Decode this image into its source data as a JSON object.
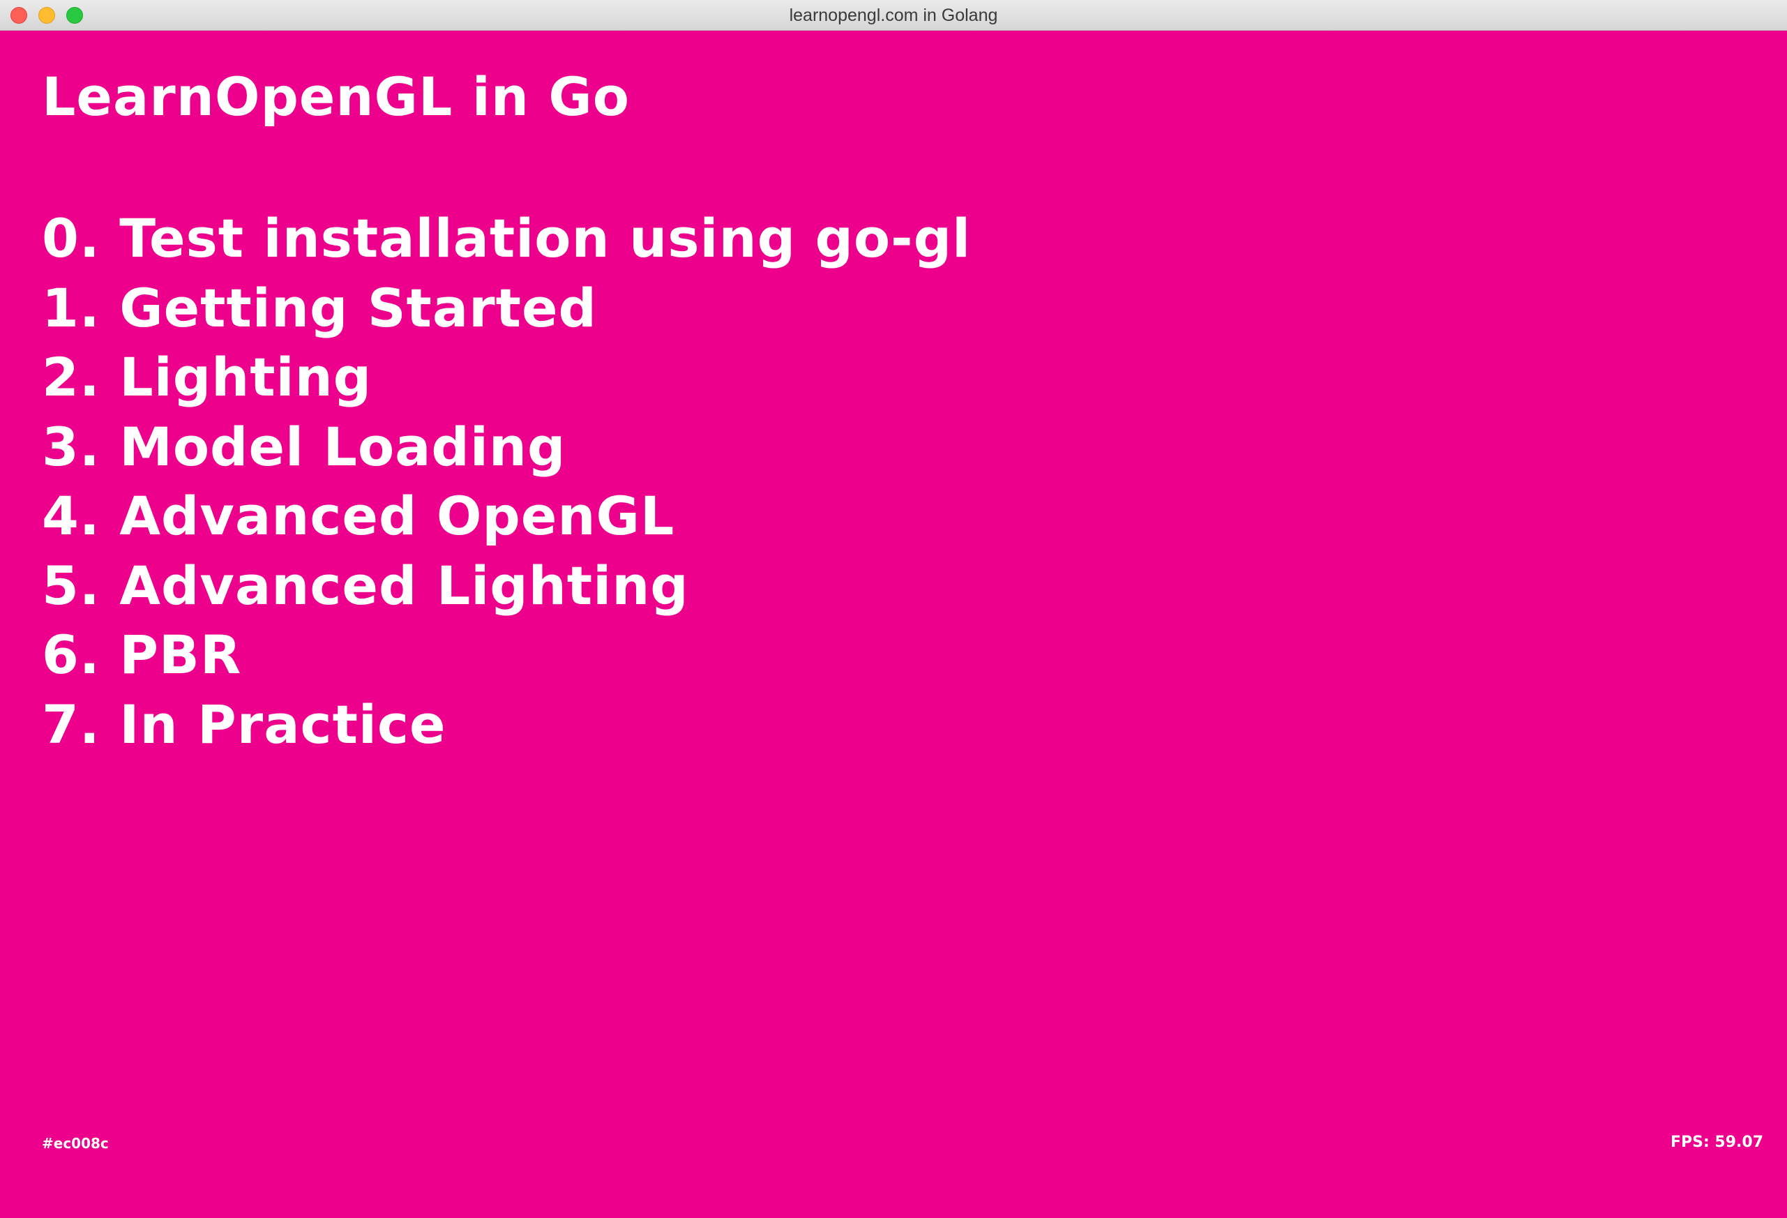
{
  "window": {
    "title": "learnopengl.com in Golang",
    "controls": [
      "close-button",
      "minimize-button",
      "zoom-button"
    ]
  },
  "app": {
    "title": "LearnOpenGL in Go",
    "background_color": "#ec008c",
    "text_color": "#ffffff",
    "menu": [
      {
        "label": "0. Test installation using go-gl"
      },
      {
        "label": "1. Getting Started"
      },
      {
        "label": "2. Lighting"
      },
      {
        "label": "3. Model Loading"
      },
      {
        "label": "4. Advanced OpenGL"
      },
      {
        "label": "5. Advanced Lighting"
      },
      {
        "label": "6. PBR"
      },
      {
        "label": "7. In Practice"
      }
    ],
    "footer": {
      "color_code": "#ec008c",
      "fps": "FPS: 59.07"
    }
  }
}
